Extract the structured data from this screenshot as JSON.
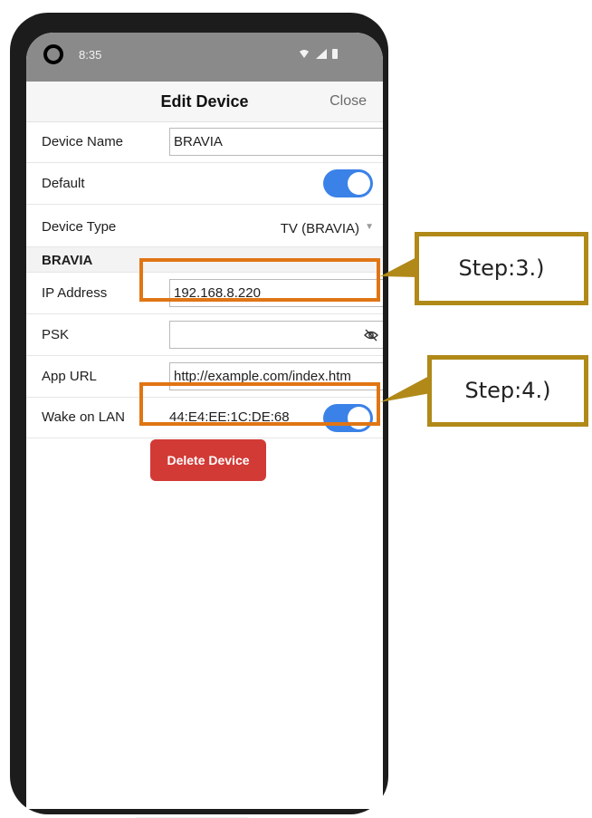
{
  "status_bar": {
    "time": "8:35"
  },
  "header": {
    "title": "Edit Device",
    "close_label": "Close"
  },
  "form": {
    "device_name_label": "Device Name",
    "device_name_value": "BRAVIA",
    "default_label": "Default",
    "default_on": true,
    "device_type_label": "Device Type",
    "device_type_value": "TV (BRAVIA)",
    "section_label": "BRAVIA",
    "ip_label": "IP Address",
    "ip_value": "192.168.8.220",
    "psk_label": "PSK",
    "psk_value": "",
    "app_url_label": "App URL",
    "app_url_value": "http://example.com/index.htm",
    "wol_label": "Wake on LAN",
    "wol_value": "44:E4:EE:1C:DE:68",
    "wol_on": true,
    "delete_label": "Delete Device"
  },
  "annotations": {
    "step3": "Step:3.)",
    "step4": "Step:4.)"
  },
  "icons": {
    "camera": "camera-icon",
    "wifi": "wifi-icon",
    "signal": "signal-icon",
    "battery": "battery-icon",
    "psk_visibility": "eye-off-icon",
    "dropdown": "chevron-down-icon"
  },
  "colors": {
    "toggle_on": "#3b82e8",
    "delete_button": "#d23a36",
    "highlight": "#e07514",
    "callout_border": "#b08918",
    "status_bar": "#8a8a8a"
  }
}
